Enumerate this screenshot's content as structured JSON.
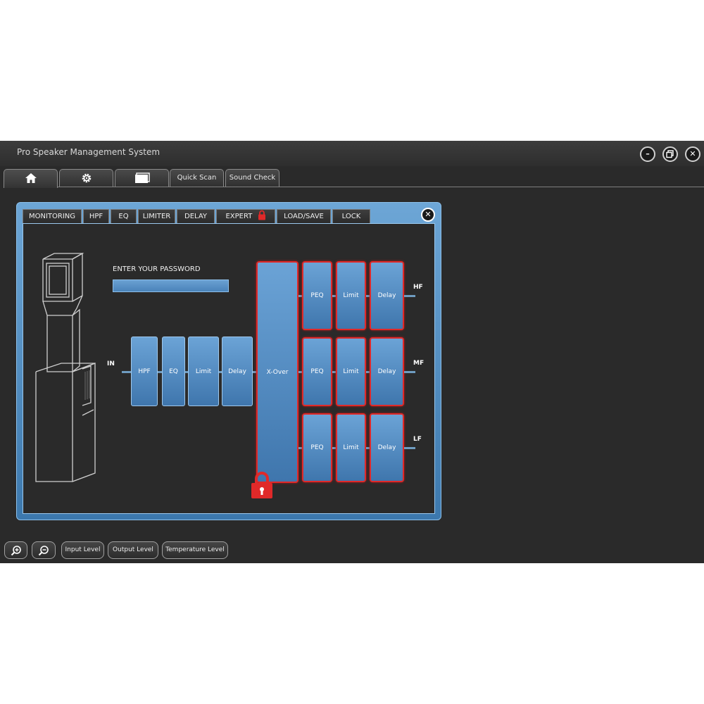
{
  "window": {
    "title": "Pro Speaker Management System",
    "minimize_icon": "minimize-icon",
    "restore_icon": "restore-icon",
    "close_icon": "close-icon"
  },
  "top_tabs": {
    "home_icon": "home-icon",
    "settings_icon": "gear-icon",
    "windows_icon": "windows-icon",
    "quick_scan": "Quick Scan",
    "sound_check": "Sound Check"
  },
  "panel": {
    "tabs": [
      "MONITORING",
      "HPF",
      "EQ",
      "LIMITER",
      "DELAY",
      "EXPERT",
      "LOAD/SAVE",
      "LOCK"
    ],
    "expert_lock_icon": "lock-icon",
    "close_icon": "close-icon",
    "password_label": "ENTER YOUR PASSWORD",
    "password_value": "",
    "speaker_image": "speaker-column-illustration"
  },
  "signal_chain": {
    "input_label": "IN",
    "input_blocks": [
      "HPF",
      "EQ",
      "Limit",
      "Delay"
    ],
    "crossover": "X-Over",
    "outputs": [
      {
        "label": "HF",
        "blocks": [
          "PEQ",
          "Limit",
          "Delay"
        ]
      },
      {
        "label": "MF",
        "blocks": [
          "PEQ",
          "Limit",
          "Delay"
        ]
      },
      {
        "label": "LF",
        "blocks": [
          "PEQ",
          "Limit",
          "Delay"
        ]
      }
    ],
    "lock_icon": "lock-icon"
  },
  "bottom_bar": {
    "zoom_in_icon": "zoom-in-icon",
    "zoom_out_icon": "zoom-out-icon",
    "input_level": "Input Level",
    "output_level": "Output Level",
    "temperature_level": "Temperature Level"
  },
  "colors": {
    "background": "#2a2a2a",
    "panel_blue": "#4a86bd",
    "block_blue": "#5a92c6",
    "lock_red": "#e02929"
  }
}
